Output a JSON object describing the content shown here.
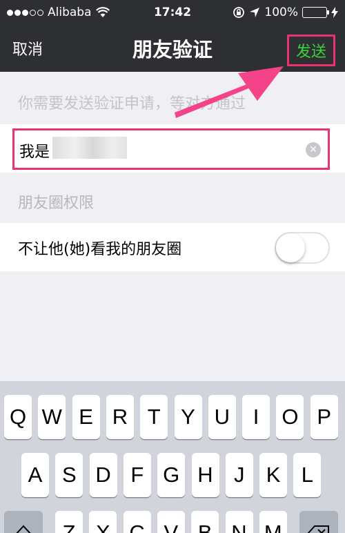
{
  "status": {
    "carrier": "Alibaba",
    "time": "17:42",
    "battery": "100%",
    "battery_level": 1.0
  },
  "nav": {
    "cancel": "取消",
    "title": "朋友验证",
    "send": "发送"
  },
  "form": {
    "hint": "你需要发送验证申请，等对方通过",
    "input_value": "我是",
    "section_label": "朋友圈权限",
    "toggle_label": "不让他(她)看我的朋友圈",
    "toggle_on": false
  },
  "keyboard": {
    "row1": [
      "Q",
      "W",
      "E",
      "R",
      "T",
      "Y",
      "U",
      "I",
      "O",
      "P"
    ],
    "row2": [
      "A",
      "S",
      "D",
      "F",
      "G",
      "H",
      "J",
      "K",
      "L"
    ],
    "row3": [
      "Z",
      "X",
      "C",
      "V",
      "B",
      "N",
      "M"
    ]
  },
  "colors": {
    "nav_bg": "#2d2f33",
    "send_text": "#3bd33b",
    "highlight": "#e8336e",
    "battery_fill": "#4cd964"
  }
}
